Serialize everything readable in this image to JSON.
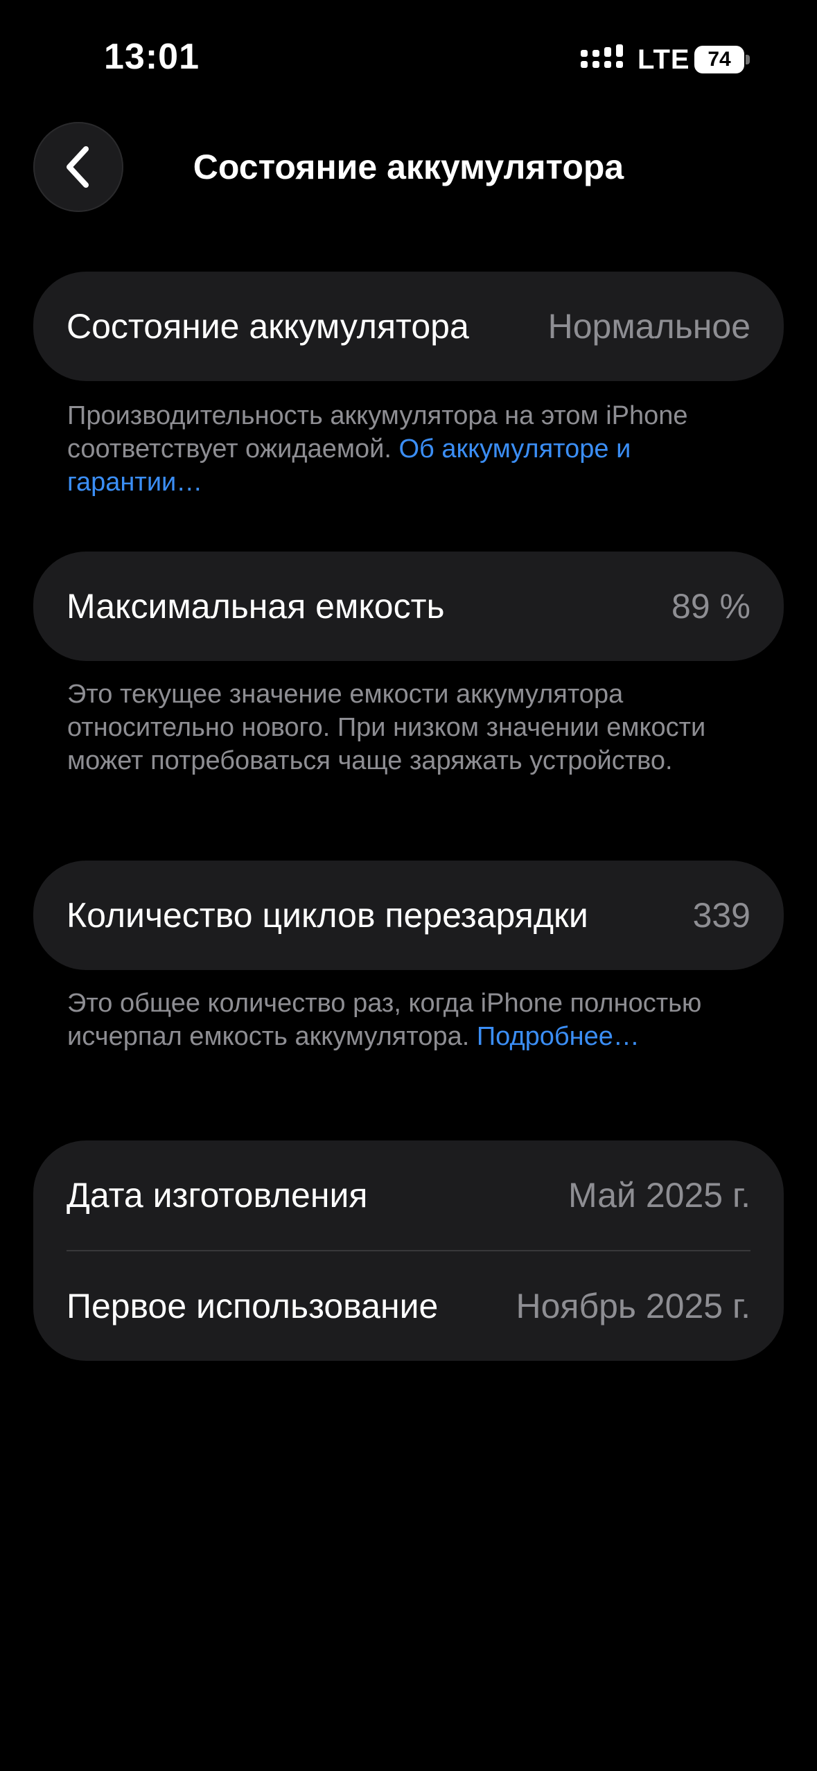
{
  "status_bar": {
    "time": "13:01",
    "network": "LTE",
    "battery_level": "74",
    "icons": [
      "signal-icon",
      "battery-icon"
    ]
  },
  "nav": {
    "back_icon": "chevron-left-icon",
    "title": "Состояние аккумулятора"
  },
  "battery_health": {
    "label": "Состояние аккумулятора",
    "value": "Нормальное",
    "footnote_text": "Производительность аккумулятора на этом iPhone соответствует ожидаемой. ",
    "footnote_link": "Об аккумуляторе и гарантии…"
  },
  "max_capacity": {
    "label": "Максимальная емкость",
    "value": "89 %",
    "footnote_text": "Это текущее значение емкости аккумулятора относительно нового. При низком значении емкости может потребоваться чаще заряжать устройство."
  },
  "cycle_count": {
    "label": "Количество циклов перезарядки",
    "value": "339",
    "footnote_text": "Это общее количество раз, когда iPhone полностью исчерпал емкость аккумулятора. ",
    "footnote_link": "Подробнее…"
  },
  "dates": {
    "manufacture_label": "Дата изготовления",
    "manufacture_value": "Май 2025 г.",
    "first_use_label": "Первое использование",
    "first_use_value": "Ноябрь 2025 г."
  },
  "colors": {
    "background": "#000000",
    "card": "#1c1c1e",
    "secondary_text": "#8e8e93",
    "link": "#3b8ef5"
  }
}
